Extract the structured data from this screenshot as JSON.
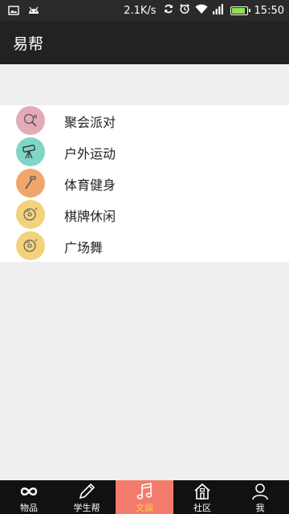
{
  "status_bar": {
    "speed": "2.1K/s",
    "time": "15:50",
    "battery_level": 0.9,
    "icons": [
      "image-icon",
      "android-icon",
      "sync-icon",
      "alarm-icon",
      "wifi-icon",
      "signal-icon",
      "battery-icon"
    ]
  },
  "header": {
    "title": "易帮"
  },
  "categories": [
    {
      "label": "聚会派对",
      "icon": "ping-pong-icon",
      "color": "#e3aab8"
    },
    {
      "label": "户外运动",
      "icon": "telescope-icon",
      "color": "#7fd6c4"
    },
    {
      "label": "体育健身",
      "icon": "hammer-icon",
      "color": "#f0a66b"
    },
    {
      "label": "棋牌休闲",
      "icon": "disc-icon",
      "color": "#f3d27c"
    },
    {
      "label": "广场舞",
      "icon": "disc-icon",
      "color": "#f3d27c"
    }
  ],
  "bottom_nav": {
    "items": [
      {
        "label": "物品",
        "icon": "infinity-icon",
        "active": false
      },
      {
        "label": "学生帮",
        "icon": "pencil-icon",
        "active": false
      },
      {
        "label": "文娱",
        "icon": "music-note-icon",
        "active": true
      },
      {
        "label": "社区",
        "icon": "home-icon",
        "active": false
      },
      {
        "label": "我",
        "icon": "user-icon",
        "active": false
      }
    ],
    "active_color": "#f47b6b",
    "active_text_color": "#f7d13a"
  }
}
